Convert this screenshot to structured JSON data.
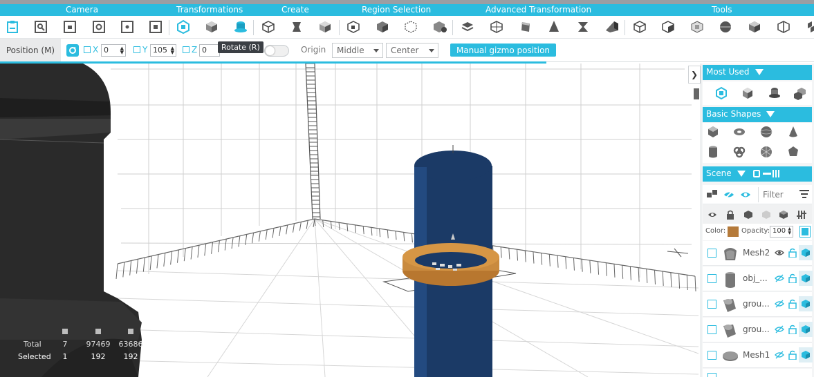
{
  "categories": [
    "Camera",
    "Transformations",
    "Create",
    "Region Selection",
    "Advanced Transformation",
    "Tools"
  ],
  "toolbar_icons": [
    "clipboard-icon",
    "zoom-select-icon",
    "camera-save-icon",
    "camera-refresh-icon",
    "camera-settings-icon",
    "camera-fit-icon",
    "move-icon",
    "rotate-icon",
    "scale-icon",
    "create-box-icon",
    "create-shape-icon",
    "create-cube-icon",
    "region-select-icon",
    "region-cube-icon",
    "region-frame-icon",
    "region-add-icon",
    "adv-transform-1-icon",
    "adv-transform-2-icon",
    "adv-transform-3-icon",
    "adv-transform-4-icon",
    "adv-transform-5-icon",
    "adv-transform-6-icon",
    "tool-1-icon",
    "tool-2-icon",
    "tool-3-icon",
    "tool-4-icon",
    "tool-5-icon",
    "tool-6-icon",
    "tool-7-icon"
  ],
  "tooltip": "Rotate (R)",
  "options": {
    "mode": "Position (M)",
    "x_label": "X",
    "x_value": "0",
    "y_label": "Y",
    "y_value": "105",
    "z_label": "Z",
    "z_value": "0",
    "origin_label": "Origin",
    "origin_value": "Middle",
    "align_value": "Center",
    "manual_gizmo": "Manual gizmo position"
  },
  "stats": {
    "total_label": "Total",
    "selected_label": "Selected",
    "total": [
      "7",
      "97469",
      "63686"
    ],
    "selected": [
      "1",
      "192",
      "192"
    ]
  },
  "panel": {
    "most_used": "Most Used",
    "basic_shapes": "Basic Shapes",
    "scene": "Scene",
    "filter_placeholder": "Filter",
    "color_label": "Color:",
    "opacity_label": "Opacity:",
    "opacity_value": "100",
    "swatch_color": "#b57a3a",
    "scene_items": [
      {
        "name": "Mesh2"
      },
      {
        "name": "obj_..."
      },
      {
        "name": "grou..."
      },
      {
        "name": "grou..."
      },
      {
        "name": "Mesh1"
      }
    ]
  },
  "colors": {
    "accent": "#2bbcdf",
    "pillar": "#1b3a66",
    "ring": "#c98a3e"
  }
}
